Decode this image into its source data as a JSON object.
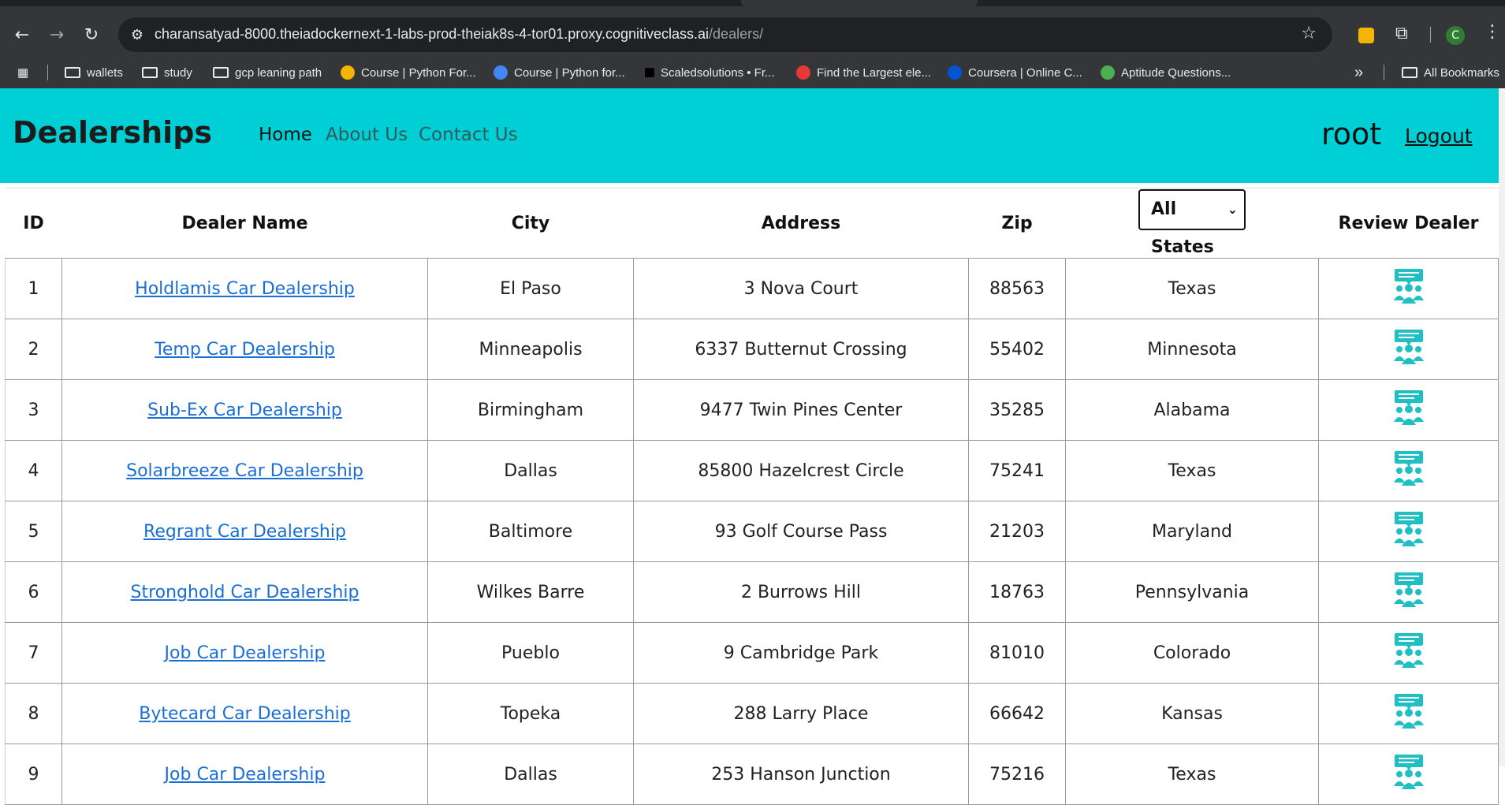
{
  "browser": {
    "url_host": "charansatyad-8000.theiadockernext-1-labs-prod-theiak8s-4-tor01.proxy.cognitiveclass.ai",
    "url_path": "/dealers/",
    "profile_initial": "C",
    "bookmarks": [
      {
        "label": "wallets",
        "type": "folder"
      },
      {
        "label": "study",
        "type": "folder"
      },
      {
        "label": "gcp leaning path",
        "type": "folder"
      },
      {
        "label": "Course | Python For...",
        "type": "link",
        "color": "#f4b400"
      },
      {
        "label": "Course | Python for...",
        "type": "link",
        "color": "#4285f4"
      },
      {
        "label": "Scaledsolutions • Fr...",
        "type": "link",
        "color": "#000000"
      },
      {
        "label": "Find the Largest ele...",
        "type": "link",
        "color": "#e53935"
      },
      {
        "label": "Coursera | Online C...",
        "type": "link",
        "color": "#0056d2"
      },
      {
        "label": "Aptitude Questions...",
        "type": "link",
        "color": "#4caf50"
      }
    ],
    "more_label": "»",
    "all_bookmarks": "All Bookmarks"
  },
  "header": {
    "brand": "Dealerships",
    "nav": [
      "Home",
      "About Us",
      "Contact Us"
    ],
    "user": "root",
    "logout": "Logout"
  },
  "table": {
    "headers": {
      "id": "ID",
      "name": "Dealer Name",
      "city": "City",
      "address": "Address",
      "zip": "Zip",
      "review": "Review Dealer"
    },
    "state_filter": "All States",
    "rows": [
      {
        "id": "1",
        "name": "Holdlamis Car Dealership",
        "city": "El Paso",
        "address": "3 Nova Court",
        "zip": "88563",
        "state": "Texas"
      },
      {
        "id": "2",
        "name": "Temp Car Dealership",
        "city": "Minneapolis",
        "address": "6337 Butternut Crossing",
        "zip": "55402",
        "state": "Minnesota"
      },
      {
        "id": "3",
        "name": "Sub-Ex Car Dealership",
        "city": "Birmingham",
        "address": "9477 Twin Pines Center",
        "zip": "35285",
        "state": "Alabama"
      },
      {
        "id": "4",
        "name": "Solarbreeze Car Dealership",
        "city": "Dallas",
        "address": "85800 Hazelcrest Circle",
        "zip": "75241",
        "state": "Texas"
      },
      {
        "id": "5",
        "name": "Regrant Car Dealership",
        "city": "Baltimore",
        "address": "93 Golf Course Pass",
        "zip": "21203",
        "state": "Maryland"
      },
      {
        "id": "6",
        "name": "Stronghold Car Dealership",
        "city": "Wilkes Barre",
        "address": "2 Burrows Hill",
        "zip": "18763",
        "state": "Pennsylvania"
      },
      {
        "id": "7",
        "name": "Job Car Dealership",
        "city": "Pueblo",
        "address": "9 Cambridge Park",
        "zip": "81010",
        "state": "Colorado"
      },
      {
        "id": "8",
        "name": "Bytecard Car Dealership",
        "city": "Topeka",
        "address": "288 Larry Place",
        "zip": "66642",
        "state": "Kansas"
      },
      {
        "id": "9",
        "name": "Job Car Dealership",
        "city": "Dallas",
        "address": "253 Hanson Junction",
        "zip": "75216",
        "state": "Texas"
      }
    ]
  },
  "colors": {
    "header_bg": "#00cfd5",
    "link": "#1a6fd6",
    "icon": "#1fbfc4"
  }
}
